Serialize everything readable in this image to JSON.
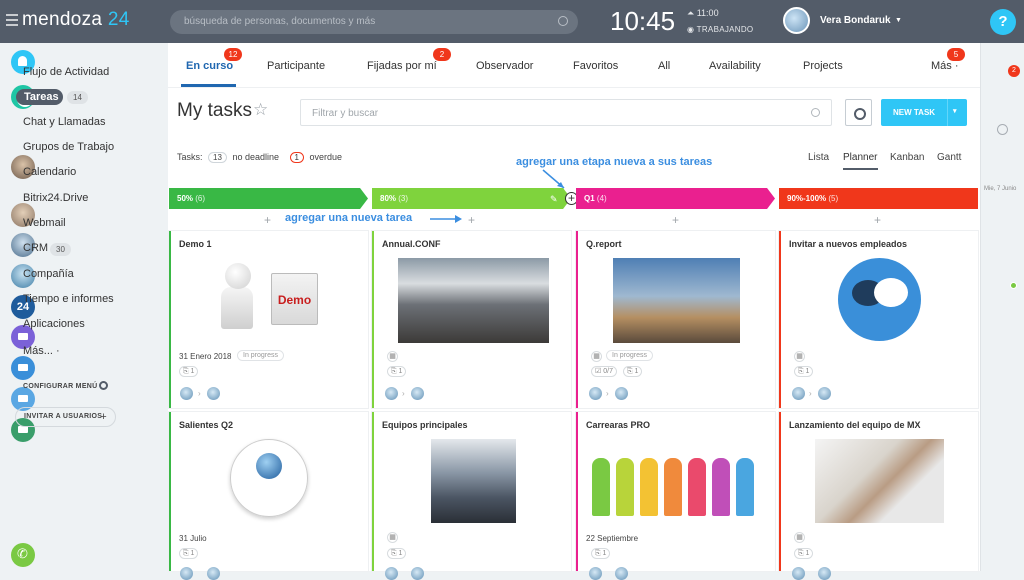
{
  "header": {
    "logo_main": "mendoza",
    "logo_num": "24",
    "search_placeholder": "búsqueda de personas, documentos y más",
    "time": "10:45",
    "alarm": "11:00",
    "status": "TRABAJANDO",
    "user_name": "Vera Bondaruk",
    "help": "?"
  },
  "right_bar": {
    "notif_count": "2",
    "date_label": "Mie, 7 Junio",
    "b24_label": "24"
  },
  "sidebar": {
    "items": [
      "Flujo de Actividad",
      "Tareas",
      "Chat y Llamadas",
      "Grupos de Trabajo",
      "Calendario",
      "Bitrix24.Drive",
      "Webmail",
      "CRM",
      "Compañía",
      "Tiempo e informes",
      "Aplicaciones",
      "Más... ·"
    ],
    "tareas_count": "14",
    "crm_count": "30",
    "configure": "CONFIGURAR MENÚ",
    "invite": "INVITAR A USUARIOS",
    "invite_plus": "+"
  },
  "tabs": [
    {
      "label": "En curso",
      "badge": "12"
    },
    {
      "label": "Participante",
      "badge": ""
    },
    {
      "label": "Fijadas por mí",
      "badge": "2"
    },
    {
      "label": "Observador",
      "badge": ""
    },
    {
      "label": "Favoritos",
      "badge": ""
    },
    {
      "label": "All",
      "badge": ""
    },
    {
      "label": "Availability",
      "badge": ""
    },
    {
      "label": "Projects",
      "badge": ""
    },
    {
      "label": "Más ·",
      "badge": "5"
    }
  ],
  "toolbar": {
    "title": "My tasks",
    "star": "☆",
    "filter_placeholder": "Filtrar y buscar",
    "new_task": "NEW TASK",
    "new_task_arrow": "▾"
  },
  "counters": {
    "label": "Tasks:",
    "no_deadline_count": "13",
    "no_deadline": "no deadline",
    "overdue_count": "1",
    "overdue": "overdue"
  },
  "views": [
    "Lista",
    "Planner",
    "Kanban",
    "Gantt"
  ],
  "annotations": {
    "stage": "agregar una etapa nueva a sus tareas",
    "task": "agregar una nueva tarea"
  },
  "stages": [
    {
      "name": "50%",
      "count": "(6)",
      "color": "#39b845"
    },
    {
      "name": "80%",
      "count": "(3)",
      "color": "#7fd33d"
    },
    {
      "name": "Q1",
      "count": "(4)",
      "color": "#ea208f"
    },
    {
      "name": "90%-100%",
      "count": "(5)",
      "color": "#f0371b"
    }
  ],
  "cards": [
    {
      "title": "Demo 1",
      "date": "31 Enero 2018",
      "status": "In progress",
      "check": "",
      "files": "1",
      "img_text": "Demo"
    },
    {
      "title": "Annual.CONF",
      "date": "",
      "status": "",
      "check": "",
      "files": "1"
    },
    {
      "title": "Q.report",
      "date": "",
      "status": "In progress",
      "check": "0/7",
      "files": "1"
    },
    {
      "title": "Invitar a nuevos empleados",
      "date": "",
      "status": "",
      "check": "",
      "files": "1"
    },
    {
      "title": "Salientes Q2",
      "date": "31 Julio",
      "status": "",
      "check": "",
      "files": "1"
    },
    {
      "title": "Equipos principales",
      "date": "",
      "status": "",
      "check": "",
      "files": "1"
    },
    {
      "title": "Carrearas PRO",
      "date": "22 Septiembre",
      "status": "",
      "check": "",
      "files": "1"
    },
    {
      "title": "Lanzamiento del equipo de MX",
      "date": "",
      "status": "",
      "check": "",
      "files": "1"
    }
  ]
}
